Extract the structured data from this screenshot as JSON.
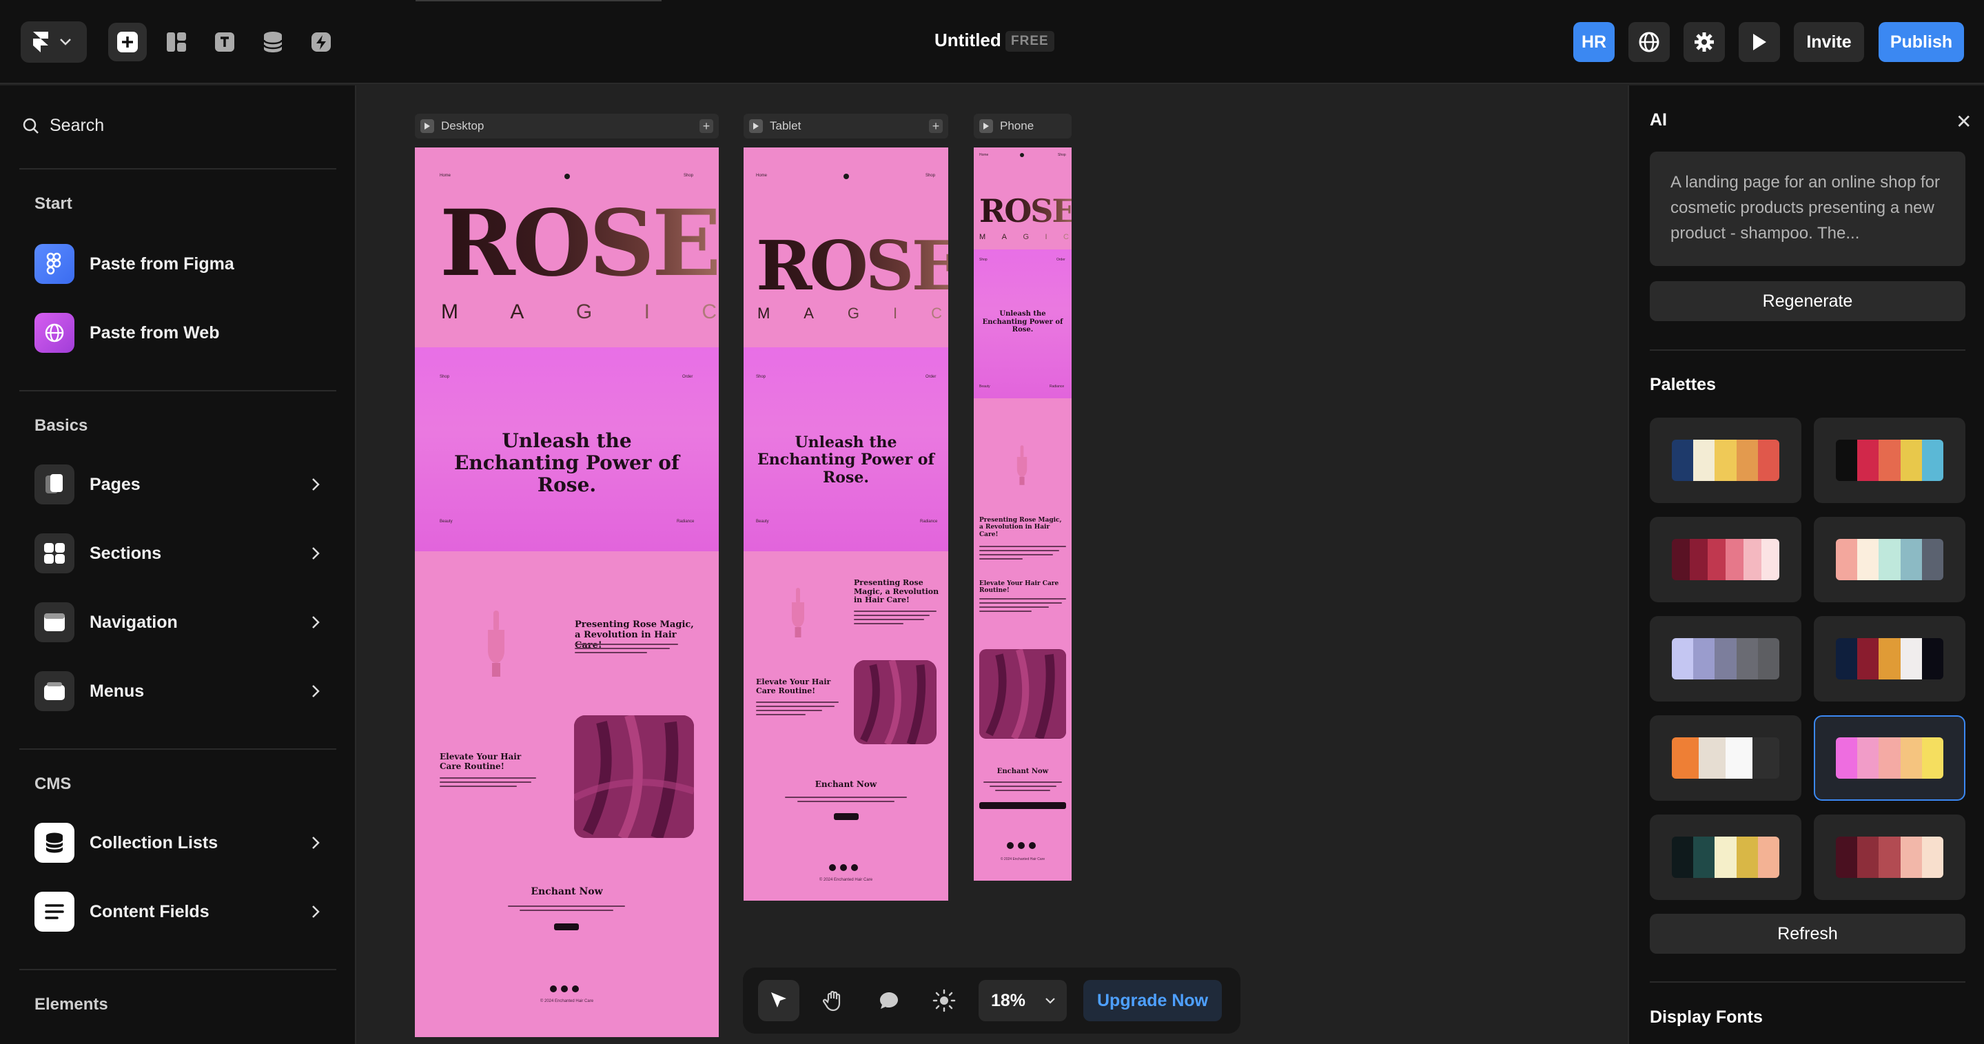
{
  "topbar": {
    "title": "Untitled",
    "plan_badge": "FREE",
    "avatar_initials": "HR",
    "invite_label": "Invite",
    "publish_label": "Publish"
  },
  "left_sidebar": {
    "search_label": "Search",
    "start_section": "Start",
    "start_items": [
      {
        "label": "Paste from Figma",
        "icon": "figma-icon"
      },
      {
        "label": "Paste from Web",
        "icon": "globe-icon"
      }
    ],
    "basics_section": "Basics",
    "basics_items": [
      {
        "label": "Pages",
        "icon": "pages-icon"
      },
      {
        "label": "Sections",
        "icon": "sections-icon"
      },
      {
        "label": "Navigation",
        "icon": "navigation-icon"
      },
      {
        "label": "Menus",
        "icon": "menus-icon"
      }
    ],
    "cms_section": "CMS",
    "cms_items": [
      {
        "label": "Collection Lists",
        "icon": "database-icon"
      },
      {
        "label": "Content Fields",
        "icon": "lines-icon"
      }
    ],
    "elements_section": "Elements"
  },
  "canvas": {
    "frames": [
      {
        "label": "Desktop"
      },
      {
        "label": "Tablet"
      },
      {
        "label": "Phone"
      }
    ],
    "site": {
      "brand_word": "ROSE",
      "brand_letters": [
        "M",
        "A",
        "G",
        "I",
        "C"
      ],
      "brand_letters_phone": [
        "M",
        "A",
        "G",
        "I",
        "C"
      ],
      "phone_brand_word": "ROSE",
      "nav_left": "Home",
      "nav_right": "Shop",
      "hero_headline": "Unleash the Enchanting Power of Rose.",
      "hero_left": "Shop",
      "hero_right": "Order",
      "hero_bottom_left": "Beauty",
      "hero_bottom_right": "Radiance",
      "feature_title": "Presenting Rose Magic, a Revolution in Hair Care!",
      "routine_title": "Elevate Your Hair Care Routine!",
      "cta_title": "Enchant Now",
      "copyright": "© 2024 Enchanted Hair Care"
    }
  },
  "bottom_toolbar": {
    "zoom_value": "18%",
    "upgrade_label": "Upgrade Now"
  },
  "right_panel": {
    "ai_title": "AI",
    "prompt_text": "A landing page for an online shop for cosmetic products presenting a new product - shampoo. The...",
    "regenerate_label": "Regenerate",
    "palettes_title": "Palettes",
    "palettes": [
      {
        "colors": [
          "#1e3a6b",
          "#f3ecd4",
          "#efc957",
          "#e39a4e",
          "#e0584b"
        ],
        "selected": false
      },
      {
        "colors": [
          "#0e0e0e",
          "#d1284a",
          "#e56a4e",
          "#e8c84b",
          "#5bb8d6"
        ],
        "selected": false
      },
      {
        "colors": [
          "#5a1224",
          "#8a1c34",
          "#c0384f",
          "#e6788a",
          "#f4b8c0",
          "#fbe3e4"
        ],
        "selected": false
      },
      {
        "colors": [
          "#f3a79d",
          "#fbeedd",
          "#bfe8dc",
          "#8cbac4",
          "#5b6270"
        ],
        "selected": false
      },
      {
        "colors": [
          "#c4c6f2",
          "#9a9ccd",
          "#7c7e9c",
          "#6a6b73",
          "#5d5e62"
        ],
        "selected": false
      },
      {
        "colors": [
          "#0f1f3d",
          "#8a1c2e",
          "#e09b36",
          "#f0eded",
          "#0b0b14"
        ],
        "selected": false
      },
      {
        "colors": [
          "#ee7f35",
          "#e6ddd2",
          "#f8f8f8",
          "#2f2f2f"
        ],
        "selected": false
      },
      {
        "colors": [
          "#ee6de0",
          "#f19cc8",
          "#f4aaa4",
          "#f5c47f",
          "#f5de5f"
        ],
        "selected": true
      },
      {
        "colors": [
          "#0f1a1c",
          "#204a48",
          "#f5efc9",
          "#d9b746",
          "#f3b294"
        ],
        "selected": false
      },
      {
        "colors": [
          "#4a1020",
          "#8d2e3a",
          "#b24b52",
          "#f2b7a9",
          "#f8dfcd"
        ],
        "selected": false
      }
    ],
    "refresh_label": "Refresh",
    "display_fonts_title": "Display Fonts"
  }
}
